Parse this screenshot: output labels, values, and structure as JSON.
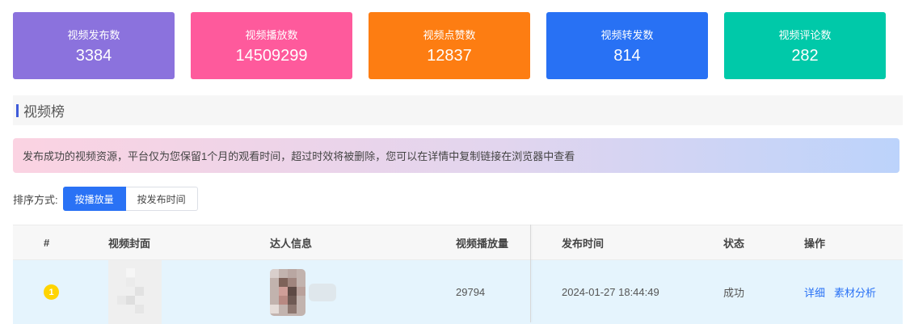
{
  "stats": [
    {
      "label": "视频发布数",
      "value": "3384",
      "color": "#8b72dd"
    },
    {
      "label": "视频播放数",
      "value": "14509299",
      "color": "#fe5a9c"
    },
    {
      "label": "视频点赞数",
      "value": "12837",
      "color": "#fd7d12"
    },
    {
      "label": "视频转发数",
      "value": "814",
      "color": "#2871f4"
    },
    {
      "label": "视频评论数",
      "value": "282",
      "color": "#00c9a9"
    }
  ],
  "section": {
    "title": "视频榜"
  },
  "notice": "发布成功的视频资源，平台仅为您保留1个月的观看时间，超过时效将被删除，您可以在详情中复制链接在浏览器中查看",
  "sort": {
    "label": "排序方式:",
    "options": [
      "按播放量",
      "按发布时间"
    ],
    "selected": "按播放量"
  },
  "table": {
    "headers": [
      "#",
      "视频封面",
      "达人信息",
      "视频播放量",
      "发布时间",
      "状态",
      "操作"
    ],
    "rows": [
      {
        "rank": "1",
        "plays": "29794",
        "published": "2024-01-27 18:44:49",
        "status": "成功",
        "actions": [
          "详细",
          "素材分析"
        ]
      }
    ]
  }
}
